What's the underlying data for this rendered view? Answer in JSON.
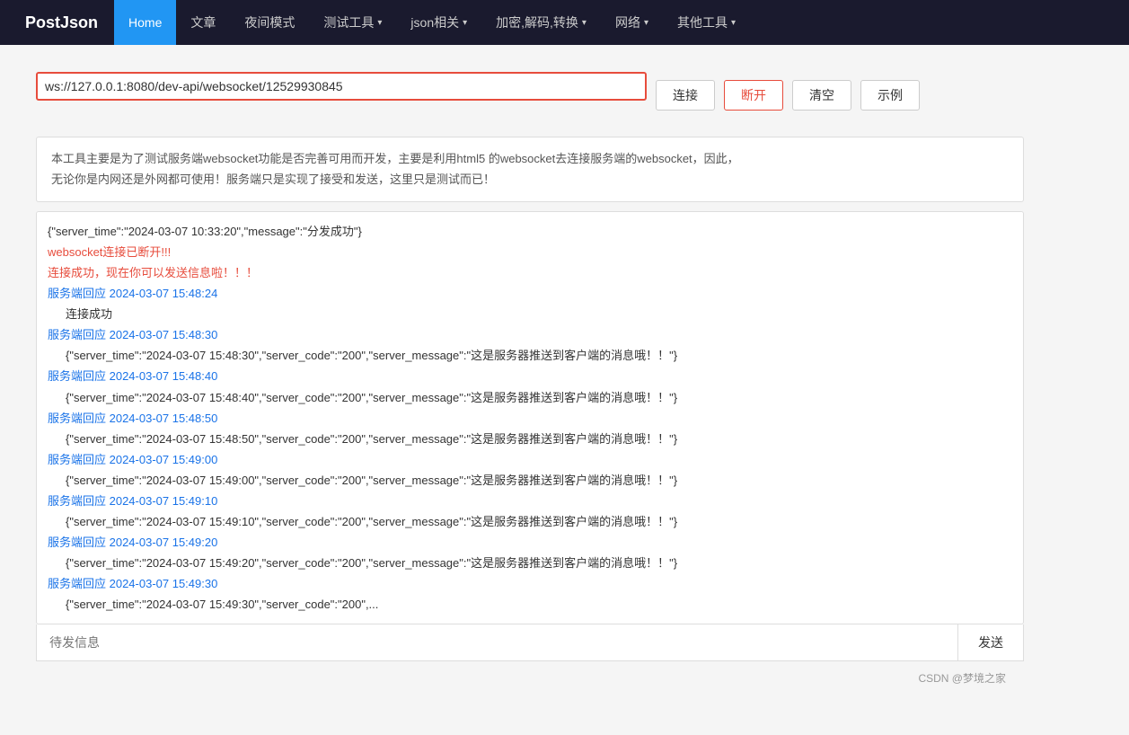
{
  "navbar": {
    "brand": "PostJson",
    "items": [
      {
        "label": "Home",
        "active": true,
        "hasDropdown": false
      },
      {
        "label": "文章",
        "active": false,
        "hasDropdown": false
      },
      {
        "label": "夜间模式",
        "active": false,
        "hasDropdown": false
      },
      {
        "label": "测试工具",
        "active": false,
        "hasDropdown": true
      },
      {
        "label": "json相关",
        "active": false,
        "hasDropdown": true
      },
      {
        "label": "加密,解码,转换",
        "active": false,
        "hasDropdown": true
      },
      {
        "label": "网络",
        "active": false,
        "hasDropdown": true
      },
      {
        "label": "其他工具",
        "active": false,
        "hasDropdown": true
      }
    ]
  },
  "url_bar": {
    "value": "ws://127.0.0.1:8080/dev-api/websocket/12529930845",
    "placeholder": "ws://127.0.0.1:8080/dev-api/websocket/12529930845"
  },
  "buttons": {
    "connect": "连接",
    "disconnect": "断开",
    "clear": "清空",
    "example": "示例",
    "send": "发送"
  },
  "info_text": {
    "line1": "本工具主要是为了测试服务端websocket功能是否完善可用而开发，主要是利用html5 的websocket去连接服务端的websocket，因此，",
    "line2": "无论你是内网还是外网都可使用！服务端只是实现了接受和发送，这里只是测试而已！"
  },
  "messages": [
    {
      "type": "normal",
      "text": "{\"server_time\":\"2024-03-07 10:33:20\",\"message\":\"分发成功\"}"
    },
    {
      "type": "red",
      "text": "websocket连接已断开!!!"
    },
    {
      "type": "red",
      "text": "连接成功，现在你可以发送信息啦！！！"
    },
    {
      "type": "blue",
      "text": "服务端回应 2024-03-07 15:48:24"
    },
    {
      "type": "indent",
      "text": "    连接成功"
    },
    {
      "type": "blue",
      "text": "服务端回应 2024-03-07 15:48:30"
    },
    {
      "type": "server-data",
      "text": "    {\"server_time\":\"2024-03-07 15:48:30\",\"server_code\":\"200\",\"server_message\":\"这是服务器推送到客户端的消息哦！！\"}"
    },
    {
      "type": "blue",
      "text": "服务端回应 2024-03-07 15:48:40"
    },
    {
      "type": "server-data",
      "text": "    {\"server_time\":\"2024-03-07 15:48:40\",\"server_code\":\"200\",\"server_message\":\"这是服务器推送到客户端的消息哦！！\"}"
    },
    {
      "type": "blue",
      "text": "服务端回应 2024-03-07 15:48:50"
    },
    {
      "type": "server-data",
      "text": "    {\"server_time\":\"2024-03-07 15:48:50\",\"server_code\":\"200\",\"server_message\":\"这是服务器推送到客户端的消息哦！！\"}"
    },
    {
      "type": "blue",
      "text": "服务端回应 2024-03-07 15:49:00"
    },
    {
      "type": "server-data",
      "text": "    {\"server_time\":\"2024-03-07 15:49:00\",\"server_code\":\"200\",\"server_message\":\"这是服务器推送到客户端的消息哦！！\"}"
    },
    {
      "type": "blue",
      "text": "服务端回应 2024-03-07 15:49:10"
    },
    {
      "type": "server-data",
      "text": "    {\"server_time\":\"2024-03-07 15:49:10\",\"server_code\":\"200\",\"server_message\":\"这是服务器推送到客户端的消息哦！！\"}"
    },
    {
      "type": "blue",
      "text": "服务端回应 2024-03-07 15:49:20"
    },
    {
      "type": "server-data",
      "text": "    {\"server_time\":\"2024-03-07 15:49:20\",\"server_code\":\"200\",\"server_message\":\"这是服务器推送到客户端的消息哦！！\"}"
    },
    {
      "type": "blue",
      "text": "服务端回应 2024-03-07 15:49:30"
    },
    {
      "type": "server-data",
      "text": "    {\"server_time\":\"2024-03-07 15:49:30\",\"server_code\":\"200\",..."
    }
  ],
  "send_placeholder": "待发信息",
  "footer_text": "CSDN @梦境之家"
}
